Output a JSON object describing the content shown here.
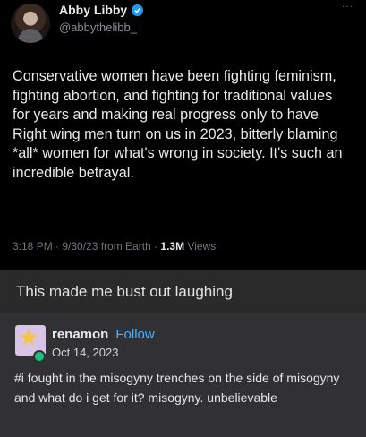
{
  "tweet": {
    "display_name": "Abby Libby",
    "handle": "@abbythelibb_",
    "more_label": "···",
    "text": "Conservative women have been fighting feminism, fighting abortion, and fighting for traditional values for years and making real progress only to have Right wing men turn on us in 2023, bitterly blaming *all* women for what's wrong in society. It's such an incredible betrayal.",
    "meta_prefix": "3:18 PM · 9/30/23 from Earth · ",
    "views_count": "1.3M",
    "views_label": " Views",
    "verified_icon": "verified-check",
    "accent_color": "#1d9bf0"
  },
  "comment": {
    "text": "This made me bust out laughing"
  },
  "tumblr_post": {
    "username": "renamon",
    "follow_label": "Follow",
    "date": "Oct 14, 2023",
    "text": "#i fought in the misogyny trenches on the side of misogyny and what do i get for it? misogyny. unbelievable",
    "follow_color": "#4db0ff"
  }
}
